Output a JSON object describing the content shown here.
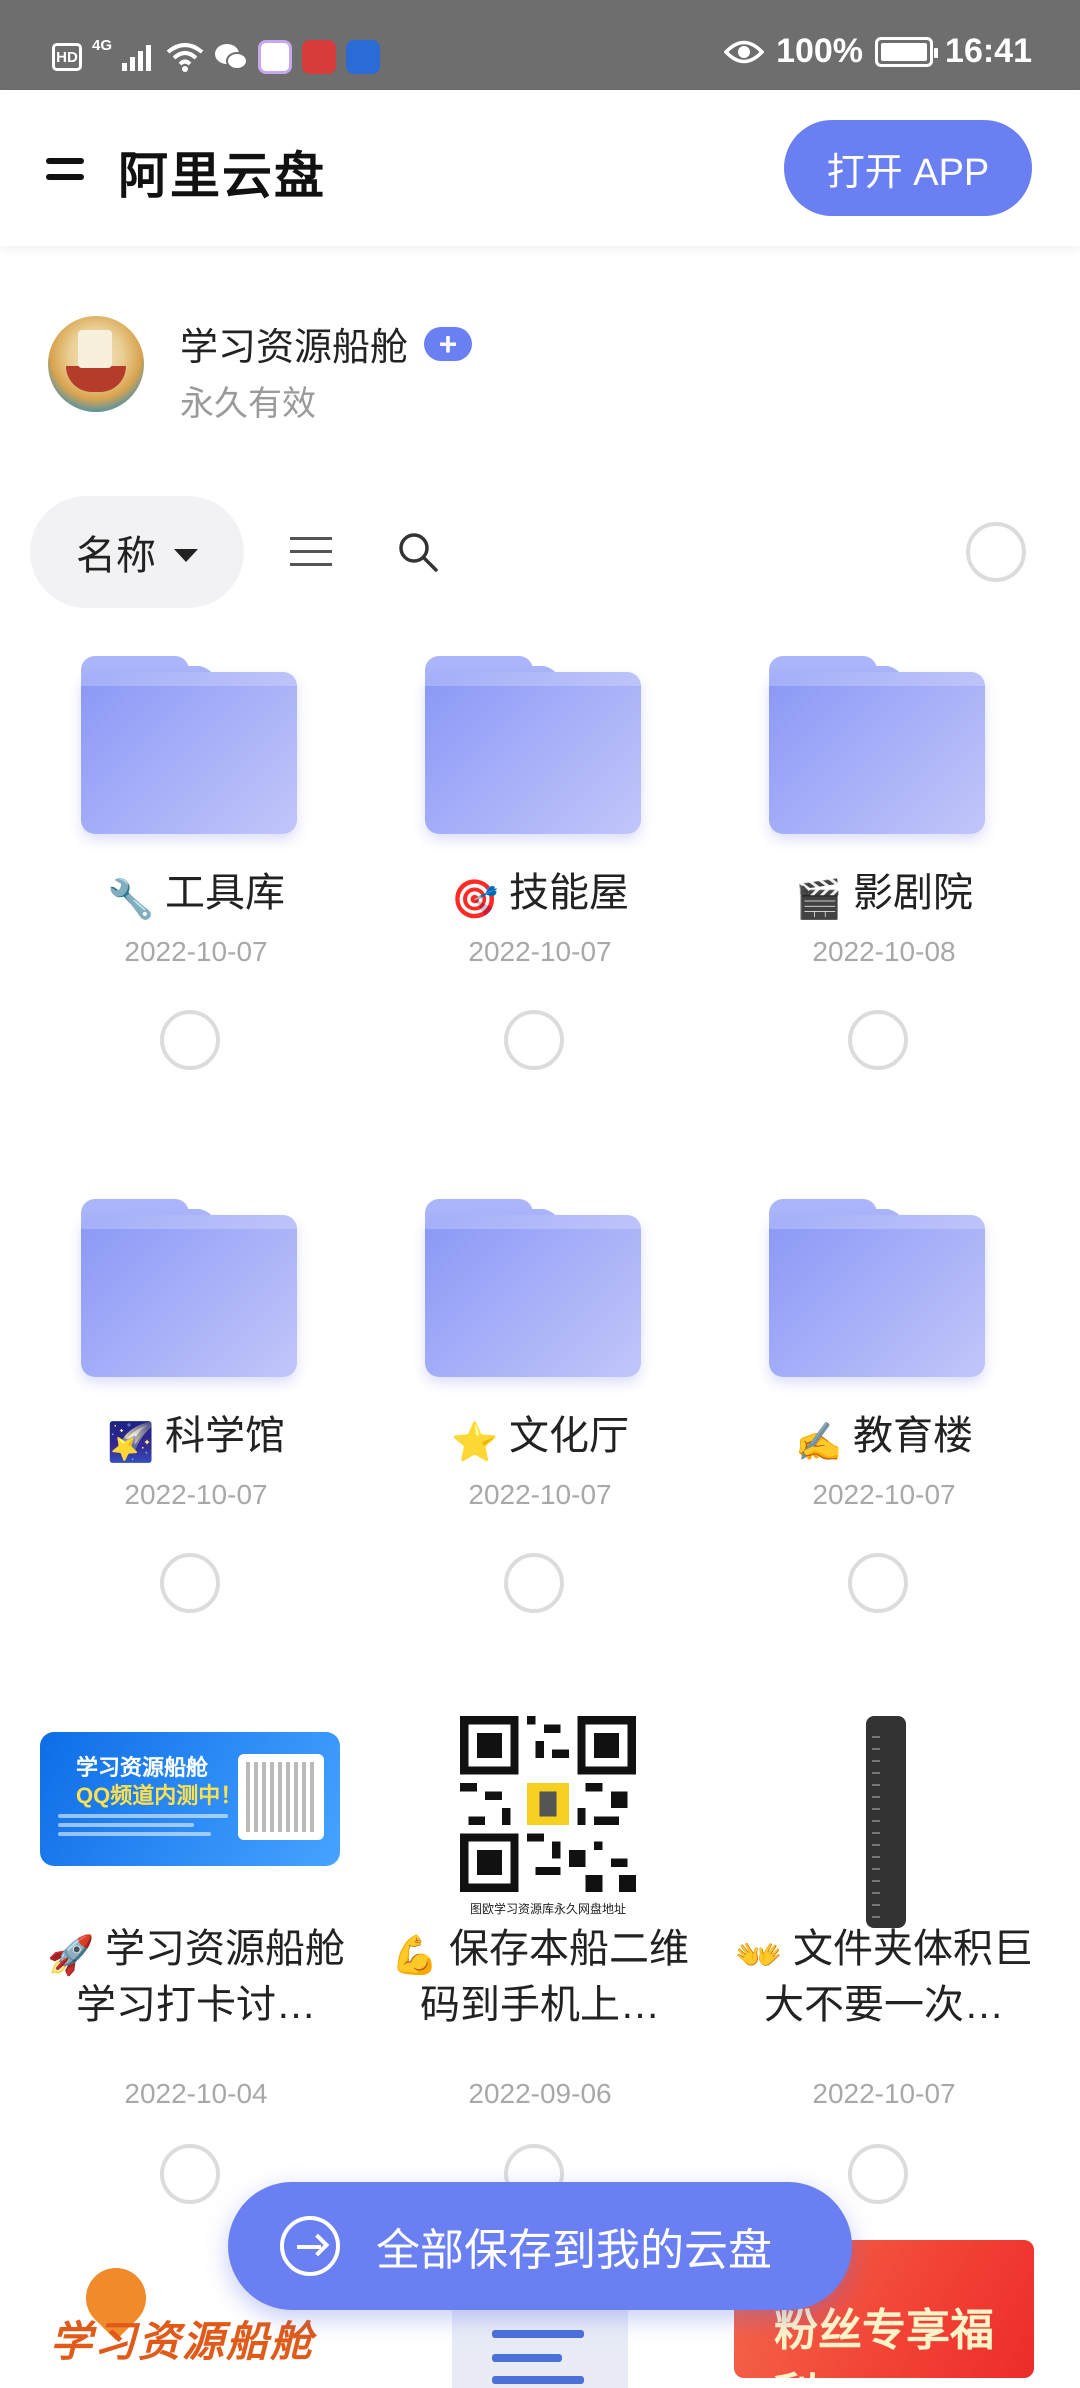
{
  "status_bar": {
    "badge": "HD",
    "network": "4G",
    "battery_percent": "100%",
    "time": "16:41",
    "app_icon_colors": [
      "#ffffff",
      "#d93b3b",
      "#2b6bd6"
    ]
  },
  "header": {
    "brand": "阿里云盘",
    "open_app_label": "打开 APP"
  },
  "share": {
    "title": "学习资源船舱",
    "plus_label": "+",
    "validity": "永久有效"
  },
  "toolbar": {
    "sort_label": "名称"
  },
  "items": [
    {
      "emoji": "🔧",
      "name": "工具库",
      "date": "2022-10-07",
      "kind": "folder"
    },
    {
      "emoji": "🎯",
      "name": "技能屋",
      "date": "2022-10-07",
      "kind": "folder"
    },
    {
      "emoji": "🎬",
      "name": "影剧院",
      "date": "2022-10-08",
      "kind": "folder"
    },
    {
      "emoji": "🌠",
      "name": "科学馆",
      "date": "2022-10-07",
      "kind": "folder"
    },
    {
      "emoji": "⭐",
      "name": "文化厅",
      "date": "2022-10-07",
      "kind": "folder"
    },
    {
      "emoji": "✍️",
      "name": "教育楼",
      "date": "2022-10-07",
      "kind": "folder"
    },
    {
      "emoji": "🚀",
      "name": "学习资源船舱学习打卡讨…",
      "date": "2022-10-04",
      "kind": "image",
      "thumb_title": "学习资源船舱",
      "thumb_subtitle": "QQ频道内测中！"
    },
    {
      "emoji": "💪",
      "name": "保存本船二维码到手机上…",
      "date": "2022-09-06",
      "kind": "image",
      "thumb_caption": "图欧学习资源库永久网盘地址"
    },
    {
      "emoji": "👐",
      "name": "文件夹体积巨大不要一次…",
      "date": "2022-10-07",
      "kind": "image"
    }
  ],
  "bottom_peek": {
    "logo_text": "学习资源船舱",
    "promo_text": "粉丝专享福利"
  },
  "save_all_label": "全部保存到我的云盘",
  "colors": {
    "accent": "#6a7ff2",
    "folder": "#a4adf8",
    "status_bar": "#6e6e6e"
  }
}
